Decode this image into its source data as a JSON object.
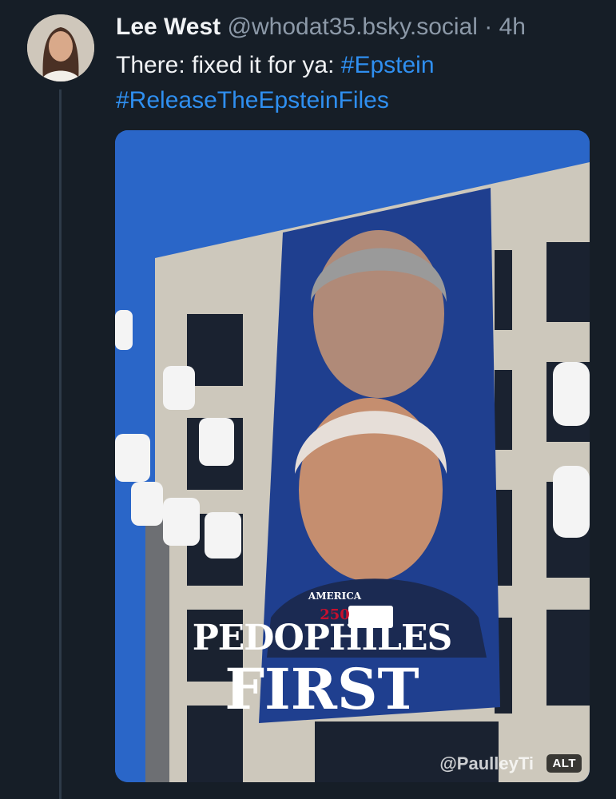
{
  "post": {
    "author_name": "Lee West",
    "handle": "@whodat35.bsky.social",
    "separator": "·",
    "time": "4h",
    "text_prefix": "There: fixed it for ya: ",
    "hashtags": [
      "#Epstein",
      "#ReleaseTheEpsteinFiles"
    ]
  },
  "media": {
    "banner_top_text": "AMERICA",
    "banner_logo_text": "250",
    "banner_line1": "PEDOPHILES",
    "banner_line2": "FIRST",
    "watermark": "@PaulleyTi",
    "alt_badge": "ALT"
  },
  "colors": {
    "background": "#161e27",
    "hashtag": "#2f8ff0",
    "muted": "#8c99a8",
    "sky": "#2a66c8",
    "banner": "#1f3f8f"
  }
}
